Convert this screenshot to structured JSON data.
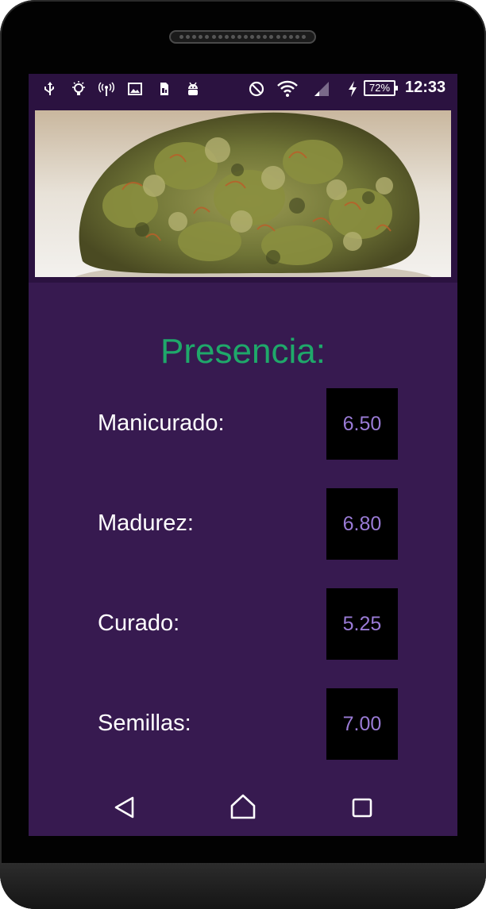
{
  "status_bar": {
    "left_icons": [
      "usb-icon",
      "lightbulb-icon",
      "hotspot-icon",
      "image-icon",
      "sim-icon",
      "android-icon"
    ],
    "right_icons": [
      "do-not-disturb-icon",
      "wifi-icon",
      "signal-icon",
      "charging-icon"
    ],
    "battery_percent": "72%",
    "time": "12:33"
  },
  "header_image": {
    "subject": "cannabis bud photo"
  },
  "section": {
    "title": "Presencia:"
  },
  "ratings": [
    {
      "label": "Manicurado:",
      "value": "6.50"
    },
    {
      "label": "Madurez:",
      "value": "6.80"
    },
    {
      "label": "Curado:",
      "value": "5.25"
    },
    {
      "label": "Semillas:",
      "value": "7.00"
    }
  ],
  "nav_bar": {
    "icons": [
      "back-icon",
      "home-icon",
      "recents-icon"
    ]
  },
  "colors": {
    "screen_bg": "#371a50",
    "status_bg": "#2b1240",
    "title_green": "#1fa86a",
    "value_purple": "#9a7bd6",
    "value_box": "#000000"
  }
}
